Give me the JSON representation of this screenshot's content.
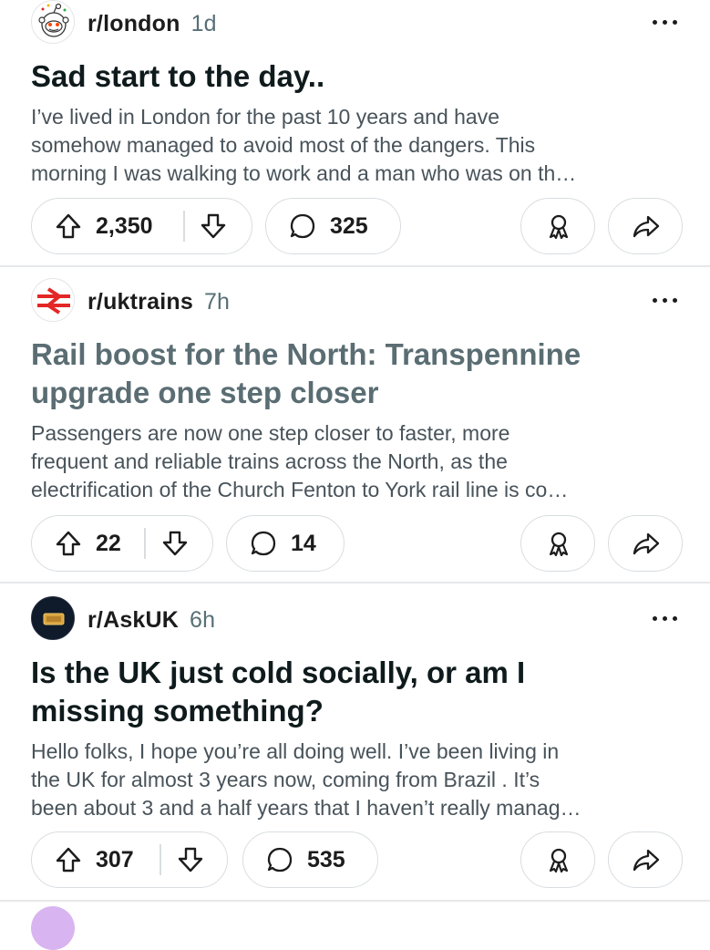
{
  "posts": [
    {
      "subreddit": "r/london",
      "age": "1d",
      "title": "Sad start to the day..",
      "body_lines": [
        "I’ve lived in London for the past 10 years and have",
        "somehow managed to avoid most of the dangers. This",
        "morning I was walking to work and a man who was on th…"
      ],
      "upvotes": "2,350",
      "comments": "325",
      "avatar_icon": "reddit-snoo-icon"
    },
    {
      "subreddit": "r/uktrains",
      "age": "7h",
      "title_lines": [
        "Rail boost for the North: Transpennine",
        "upgrade one step closer"
      ],
      "body_lines": [
        "Passengers are now one step closer to faster, more",
        "frequent and reliable trains across the North, as the",
        "electrification of the Church Fenton to York rail line is co…"
      ],
      "upvotes": "22",
      "comments": "14",
      "avatar_icon": "national-rail-icon",
      "accent": "#e32726"
    },
    {
      "subreddit": "r/AskUK",
      "age": "6h",
      "title_lines": [
        "Is the UK just cold socially, or am I",
        "missing something?"
      ],
      "body_lines": [
        "Hello folks, I hope you’re all doing well. I’ve been living in",
        "the UK for almost 3 years now, coming from Brazil . It’s",
        "been about 3 and a half years that I haven’t really manag…"
      ],
      "upvotes": "307",
      "comments": "535",
      "avatar_icon": "askuk-plaque-icon"
    }
  ],
  "colors": {
    "text": "#1c1c1c",
    "visited_title": "#5a6d73",
    "body": "#48535a",
    "border": "#d9dde0"
  }
}
